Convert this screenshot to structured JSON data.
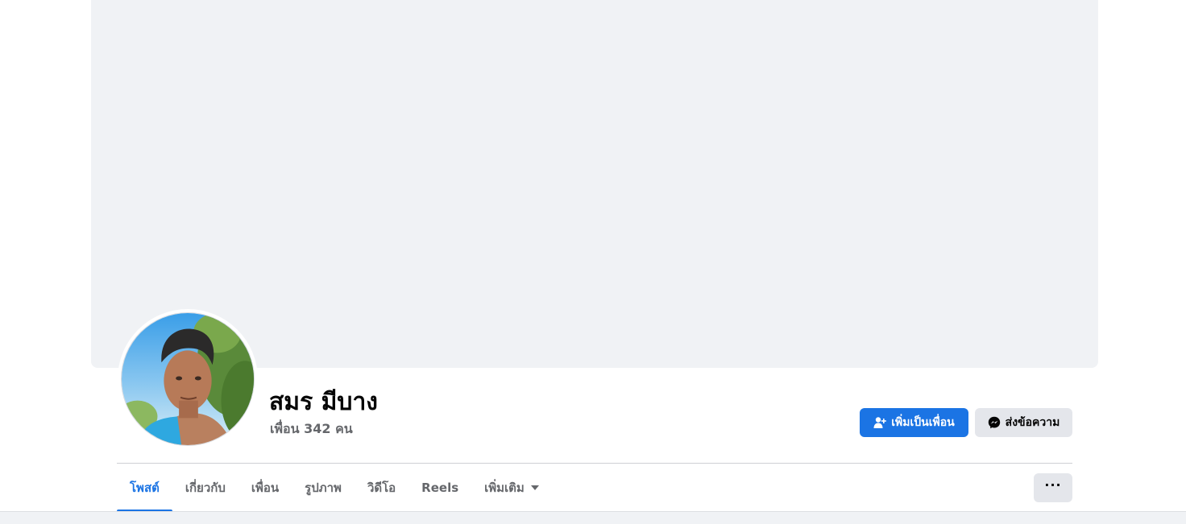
{
  "profile": {
    "name": "สมร มีบาง",
    "friends_text": "เพื่อน 342 คน"
  },
  "actions": {
    "add_friend_label": "เพิ่มเป็นเพื่อน",
    "message_label": "ส่งข้อความ",
    "more_label": "···"
  },
  "tabs": [
    {
      "label": "โพสต์",
      "active": true
    },
    {
      "label": "เกี่ยวกับ",
      "active": false
    },
    {
      "label": "เพื่อน",
      "active": false
    },
    {
      "label": "รูปภาพ",
      "active": false
    },
    {
      "label": "วิดีโอ",
      "active": false
    },
    {
      "label": "Reels",
      "active": false
    },
    {
      "label": "เพิ่มเติม",
      "active": false,
      "dropdown": true
    }
  ],
  "icons": {
    "add_friend": "add-person-icon",
    "message": "messenger-icon",
    "more": "more-dots-icon"
  },
  "colors": {
    "accent": "#1b74e4",
    "cover_bg": "#f0f2f5",
    "secondary_btn": "#e4e6eb",
    "muted_text": "#65676b"
  }
}
